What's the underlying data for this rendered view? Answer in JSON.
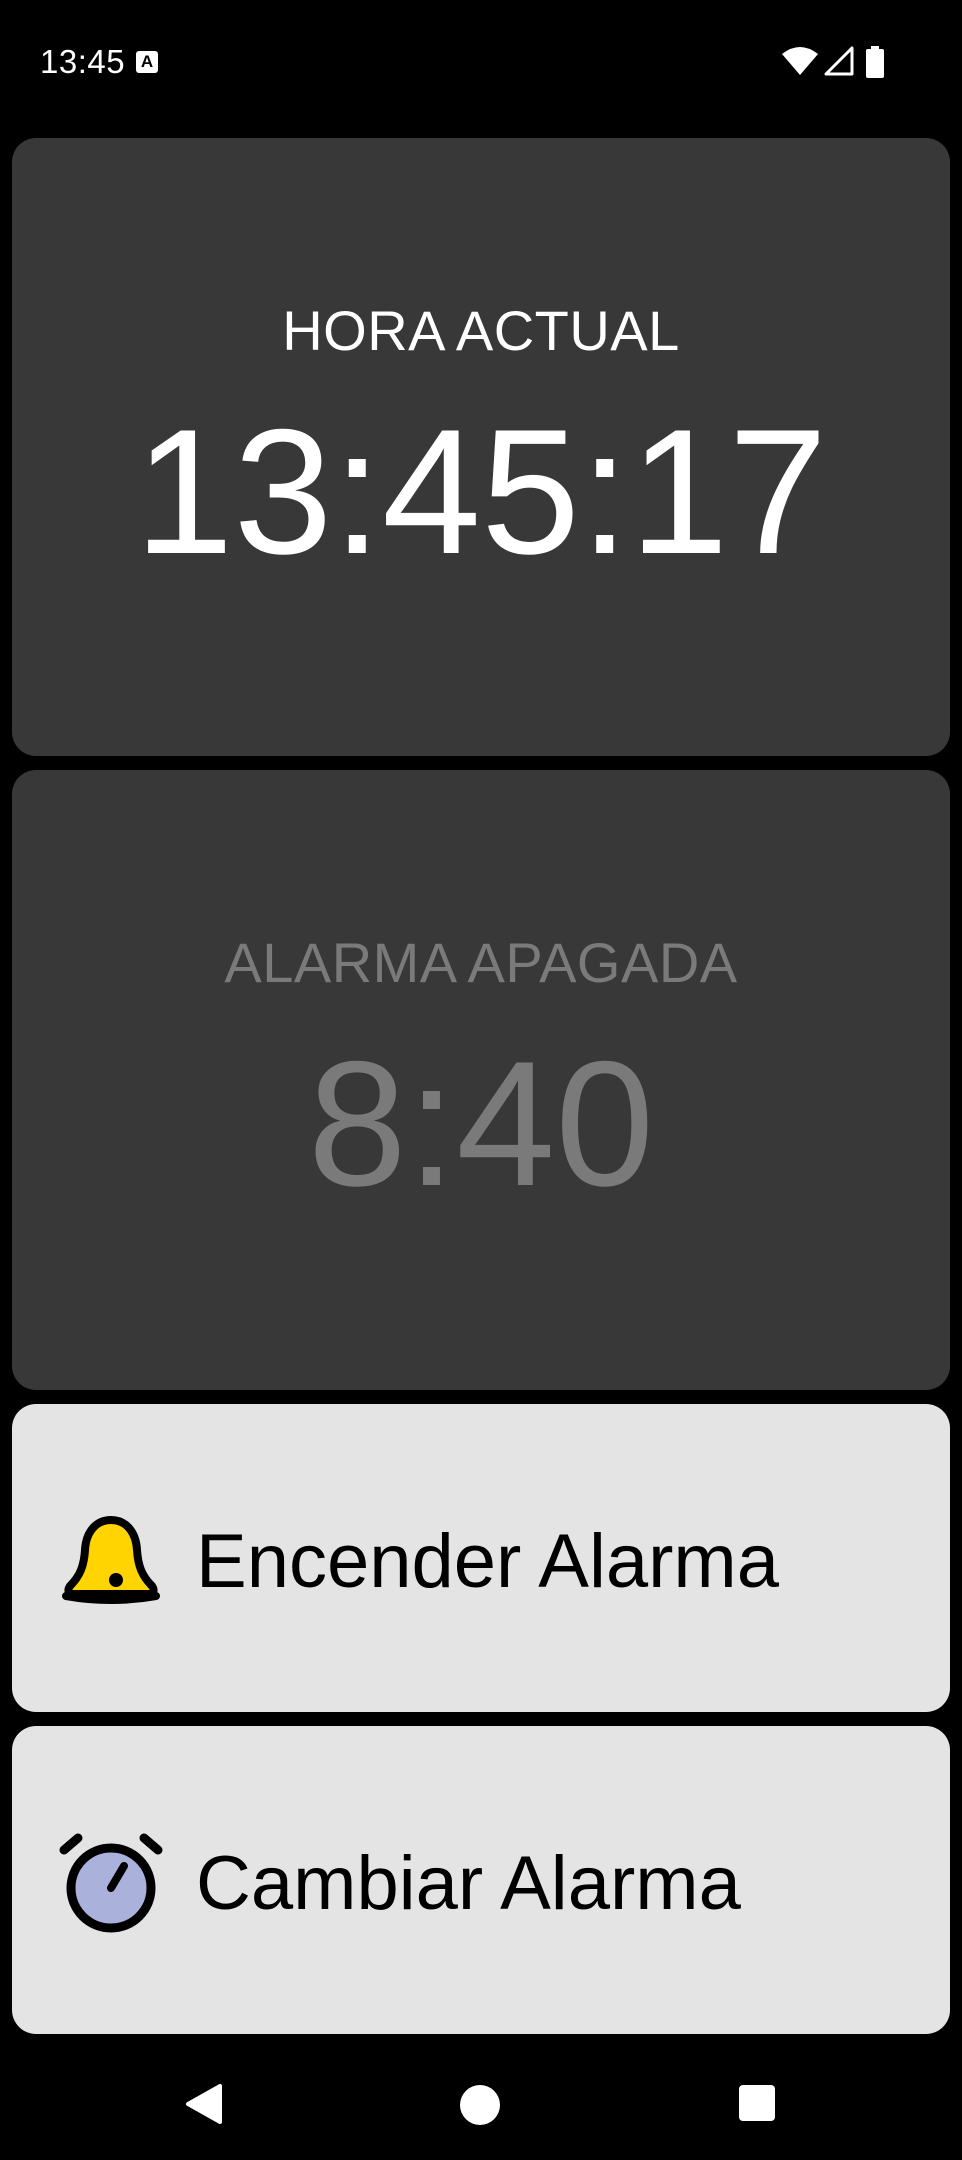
{
  "status_bar": {
    "time": "13:45",
    "notification_icon_letter": "A",
    "icons": [
      "wifi-icon",
      "cell-signal-icon",
      "battery-icon"
    ]
  },
  "current_time_card": {
    "label": "HORA ACTUAL",
    "time": "13:45:17"
  },
  "alarm_card": {
    "label": "ALARMA APAGADA",
    "time": "8:40"
  },
  "buttons": {
    "turn_on": {
      "label": "Encender Alarma",
      "icon": "bell-icon",
      "icon_color": "#ffd400"
    },
    "change": {
      "label": "Cambiar Alarma",
      "icon": "alarm-clock-icon",
      "icon_color": "#aab2dc"
    }
  },
  "colors": {
    "background": "#000000",
    "card_dark": "#383838",
    "card_light": "#e4e4e4",
    "text_active": "#ffffff",
    "text_inactive": "#7a7a7a"
  },
  "nav_bar": {
    "buttons": [
      "back-icon",
      "home-icon",
      "recents-icon"
    ]
  }
}
